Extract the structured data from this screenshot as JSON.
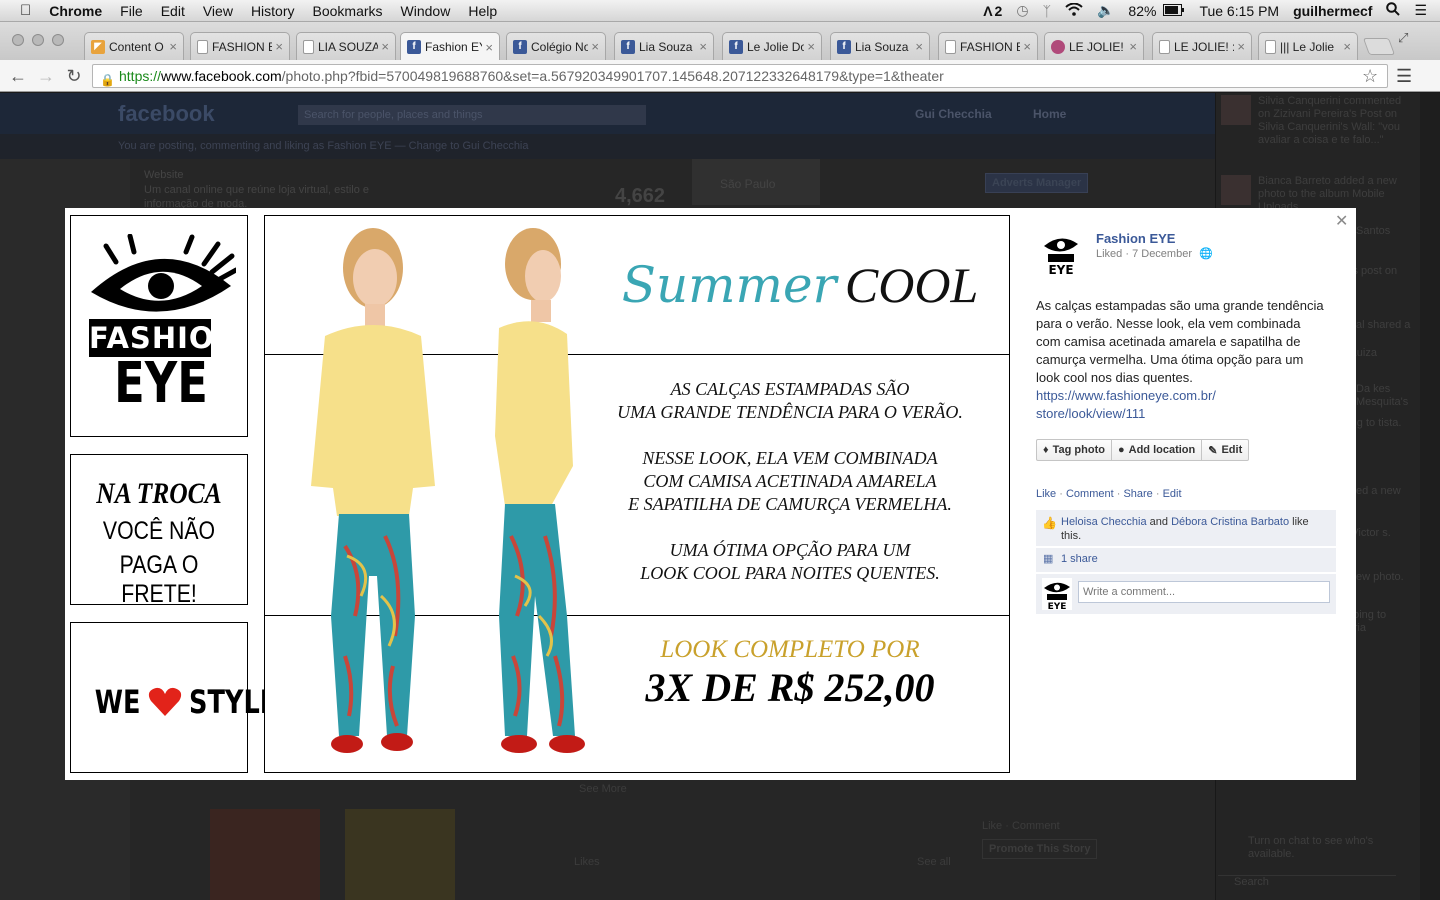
{
  "menubar": {
    "apple": "",
    "app": "Chrome",
    "items": [
      "File",
      "Edit",
      "View",
      "History",
      "Bookmarks",
      "Window",
      "Help"
    ],
    "status_num": "2",
    "battery": "82%",
    "clock": "Tue 6:15 PM",
    "user": "guilhermecf"
  },
  "tabs": [
    {
      "label": "Content O",
      "icon": "rss-icon",
      "color": "#e8a33d"
    },
    {
      "label": "FASHION E",
      "icon": "page-icon",
      "color": "#9a9a9a"
    },
    {
      "label": "LIA SOUZA",
      "icon": "page-icon",
      "color": "#9a9a9a"
    },
    {
      "label": "Fashion EY",
      "icon": "facebook-icon",
      "color": "#3b5998"
    },
    {
      "label": "Colégio No",
      "icon": "facebook-icon",
      "color": "#3b5998"
    },
    {
      "label": "Lia Souza",
      "icon": "facebook-icon",
      "color": "#3b5998"
    },
    {
      "label": "Le Jolie Do",
      "icon": "facebook-icon",
      "color": "#3b5998"
    },
    {
      "label": "Lia Souza",
      "icon": "facebook-icon",
      "color": "#3b5998"
    },
    {
      "label": "FASHION E",
      "icon": "page-icon",
      "color": "#9a9a9a"
    },
    {
      "label": "LE JOLIE! :",
      "icon": "avatar-icon",
      "color": "#b04a7a"
    },
    {
      "label": "LE JOLIE! :C",
      "icon": "page-icon",
      "color": "#9a9a9a"
    },
    {
      "label": "||| Le Jolie",
      "icon": "page-icon",
      "color": "#9a9a9a"
    }
  ],
  "address": {
    "https": "https://",
    "host": "www.facebook.com",
    "path": "/photo.php?fbid=570049819688760&set=a.567920349901707.145648.207122332648179&type=1&theater"
  },
  "background": {
    "fb_logo": "facebook",
    "search_placeholder": "Search for people, places and things",
    "user": "Gui Checchia",
    "home": "Home",
    "posting_notice": "You are posting, commenting and liking as Fashion EYE — Change to Gui Checchia",
    "website_label": "Website",
    "website_desc": "Um canal online que reúne loja virtual, estilo e informação de moda.",
    "likes_count": "4,662",
    "map_label": "São Paulo",
    "adverts_button": "Adverts Manager",
    "see_more": "See More",
    "likes_label": "Likes",
    "see_all": "See all",
    "like_comment": "Like · Comment",
    "promote": "Promote This Story",
    "chat_notice": "Turn on chat to see who's available.",
    "chat_search": "Search",
    "ticker": [
      "Silvia Canquerini commented on Zizivani Pereira's Post on Silvia Canquerini's Wall: \"vou avaliar a coisa e te falo...\"",
      "Bianca Barreto added a new photo to the album Mobile Uploads.",
      "Santos",
      "likes post on her",
      "al shared a",
      "es Luiza",
      "Da kes Mesquita's",
      "going to tista.",
      "ed a new",
      "nd Victor s.",
      "ew photo.",
      "is going to eitaria"
    ]
  },
  "ads": {
    "logo_line1": "FASHION",
    "logo_line2": "EYE",
    "troca_line1": "NA TROCA",
    "troca_line2": "VOCÊ NÃO",
    "troca_line3": "PAGA O FRETE!",
    "we": "WE",
    "style": "STYLE"
  },
  "photo": {
    "title_script": "Summer",
    "title_caps": "COOL",
    "body_lines": [
      "AS CALÇAS ESTAMPADAS SÃO",
      "UMA GRANDE TENDÊNCIA PARA O VERÃO.",
      "",
      "NESSE LOOK, ELA VEM COMBINADA",
      "COM CAMISA ACETINADA AMARELA",
      "E SAPATILHA DE CAMURÇA VERMELHA.",
      "",
      "UMA ÓTIMA OPÇÃO PARA UM",
      "LOOK COOL PARA NOITES QUENTES."
    ],
    "price_label": "LOOK COMPLETO POR",
    "price": "3X DE R$ 252,00"
  },
  "post": {
    "page_name": "Fashion EYE",
    "meta": "Liked · 7 December",
    "text": "As calças estampadas são uma grande tendência para o verão. Nesse look, ela vem combinada com camisa acetinada amarela e sapatilha de camurça vermelha. Uma ótima opção para um look cool nos dias quentes.",
    "link1": "https://www.fashioneye.com.br/",
    "link2": "store/look/view/111",
    "tag_photo": "Tag photo",
    "add_location": "Add location",
    "edit": "Edit",
    "actions": [
      "Like",
      "Comment",
      "Share",
      "Edit"
    ],
    "liker1": "Heloisa Checchia",
    "and": "and",
    "liker2": "Débora Cristina Barbato",
    "like_this": "like this.",
    "shares": "1 share",
    "comment_placeholder": "Write a comment..."
  },
  "colors": {
    "facebook_blue": "#3b5998",
    "summer_teal": "#3aa6b4",
    "gold": "#c9a12c",
    "heart_red": "#e2231a"
  }
}
